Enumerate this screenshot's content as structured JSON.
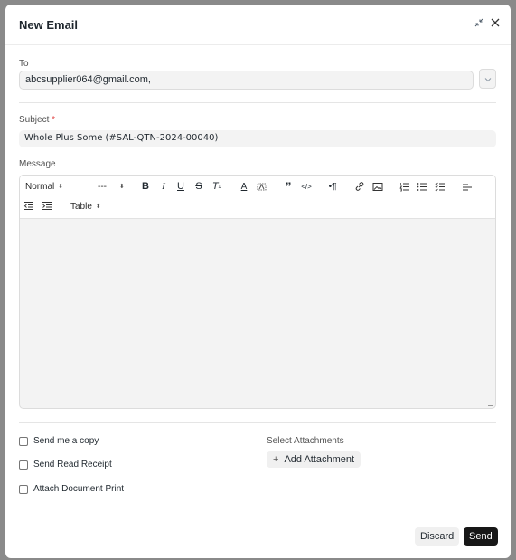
{
  "modal": {
    "title": "New Email",
    "minimize_icon": "minimize-icon",
    "close_icon": "close-icon"
  },
  "to": {
    "label": "To",
    "value": "abcsupplier064@gmail.com,"
  },
  "subject": {
    "label": "Subject",
    "required_mark": "*",
    "value": "Whole Plus Some (#SAL-QTN-2024-00040)"
  },
  "message": {
    "label": "Message",
    "toolbar": {
      "style_select": "Normal",
      "size_select": "---",
      "table_select": "Table",
      "icons": [
        "bold-icon",
        "italic-icon",
        "underline-icon",
        "strikethrough-icon",
        "clear-format-icon",
        "font-color-icon",
        "highlight-icon",
        "blockquote-icon",
        "code-icon",
        "text-direction-icon",
        "link-icon",
        "image-icon",
        "ordered-list-icon",
        "bullet-list-icon",
        "checklist-icon",
        "align-icon",
        "outdent-icon",
        "indent-icon"
      ]
    }
  },
  "options": {
    "send_copy": "Send me a copy",
    "read_receipt": "Send Read Receipt",
    "attach_print": "Attach Document Print"
  },
  "attachments": {
    "label": "Select Attachments",
    "add_label": "Add Attachment",
    "add_icon": "+"
  },
  "footer": {
    "discard": "Discard",
    "send": "Send"
  },
  "colors": {
    "primary_button": "#171717",
    "required": "#e24c4c"
  }
}
